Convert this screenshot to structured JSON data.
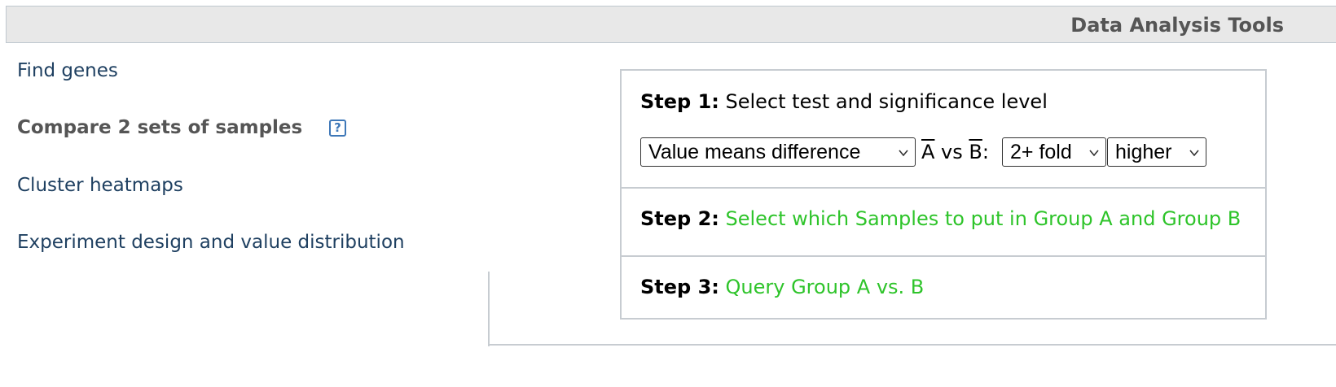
{
  "header": {
    "title": "Data Analysis Tools"
  },
  "nav": {
    "find_genes": "Find genes",
    "compare_samples": "Compare 2 sets of samples",
    "cluster_heatmaps": "Cluster heatmaps",
    "experiment_design": "Experiment design and value distribution",
    "help_glyph": "?"
  },
  "steps": {
    "step1": {
      "label": "Step 1:",
      "text": "Select test and significance level",
      "test_select": "Value means difference",
      "vs_a": "A",
      "vs_mid": " vs ",
      "vs_b": "B",
      "vs_colon": ":",
      "fold_select": "2+ fold",
      "direction_select": "higher"
    },
    "step2": {
      "label": "Step 2:",
      "text": "Select which Samples to put in Group A and Group B"
    },
    "step3": {
      "label": "Step 3:",
      "text": "Query Group A vs. B"
    }
  },
  "colors": {
    "link": "#1f4061",
    "action_green": "#2ec42a",
    "header_bg": "#e8e8e8",
    "border": "#c7ccd1",
    "help_icon": "#3e78b8"
  },
  "icons": {
    "help": "help-icon",
    "dropdown": "chevron-down-icon"
  }
}
